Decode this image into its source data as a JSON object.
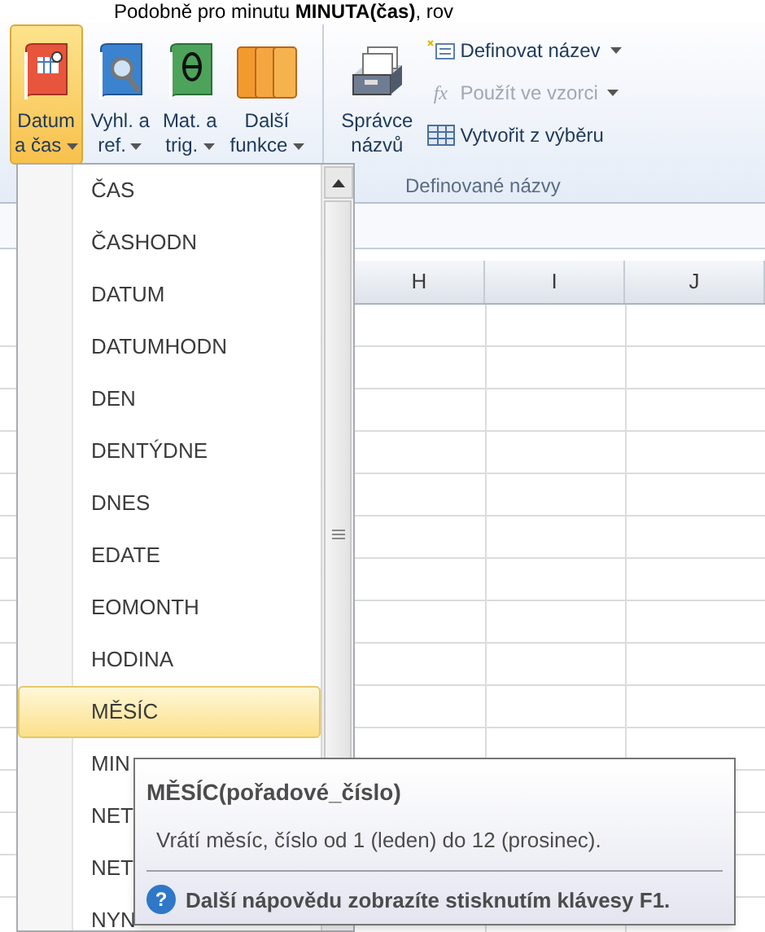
{
  "caption": "Podobně pro minutu **MINUTA(čas)**, rov",
  "ribbon": {
    "large_buttons": [
      {
        "kind": "date",
        "lines": [
          "Datum",
          "a čas"
        ],
        "dropdown": true,
        "selected": true
      },
      {
        "kind": "lookup",
        "lines": [
          "Vyhl. a",
          "ref."
        ],
        "dropdown": true,
        "selected": false
      },
      {
        "kind": "math",
        "lines": [
          "Mat. a",
          "trig."
        ],
        "dropdown": true,
        "selected": false
      },
      {
        "kind": "more",
        "lines": [
          "Další",
          "funkce"
        ],
        "dropdown": true,
        "selected": false
      },
      {
        "kind": "names",
        "lines": [
          "Správce",
          "názvů"
        ],
        "dropdown": false,
        "selected": false
      }
    ],
    "small_buttons": [
      {
        "kind": "define",
        "label": "Definovat název",
        "dropdown": true,
        "disabled": false
      },
      {
        "kind": "formula",
        "icon_text": "fx",
        "label": "Použít ve vzorci",
        "dropdown": true,
        "disabled": true
      },
      {
        "kind": "create",
        "label": "Vytvořit z výběru",
        "dropdown": false,
        "disabled": false
      }
    ],
    "group_label": "Definované názvy"
  },
  "menu": {
    "items": [
      {
        "label": "ČAS",
        "selected": false
      },
      {
        "label": "ČASHODN",
        "selected": false
      },
      {
        "label": "DATUM",
        "selected": false
      },
      {
        "label": "DATUMHODN",
        "selected": false
      },
      {
        "label": "DEN",
        "selected": false
      },
      {
        "label": "DENTÝDNE",
        "selected": false
      },
      {
        "label": "DNES",
        "selected": false
      },
      {
        "label": "EDATE",
        "selected": false
      },
      {
        "label": "EOMONTH",
        "selected": false
      },
      {
        "label": "HODINA",
        "selected": false
      },
      {
        "label": "MĚSÍC",
        "selected": true
      },
      {
        "label": "MIN",
        "selected": false
      },
      {
        "label": "NET",
        "selected": false
      },
      {
        "label": "NET",
        "selected": false
      },
      {
        "label": "NYN",
        "selected": false
      }
    ]
  },
  "sheet": {
    "columns": [
      "H",
      "I",
      "J"
    ]
  },
  "tooltip": {
    "title": "MĚSÍC(pořadové_číslo)",
    "description": "Vrátí měsíc, číslo od 1 (leden) do 12 (prosinec).",
    "help_icon": "?",
    "help": "Další nápovědu zobrazíte stisknutím klávesy F1."
  }
}
